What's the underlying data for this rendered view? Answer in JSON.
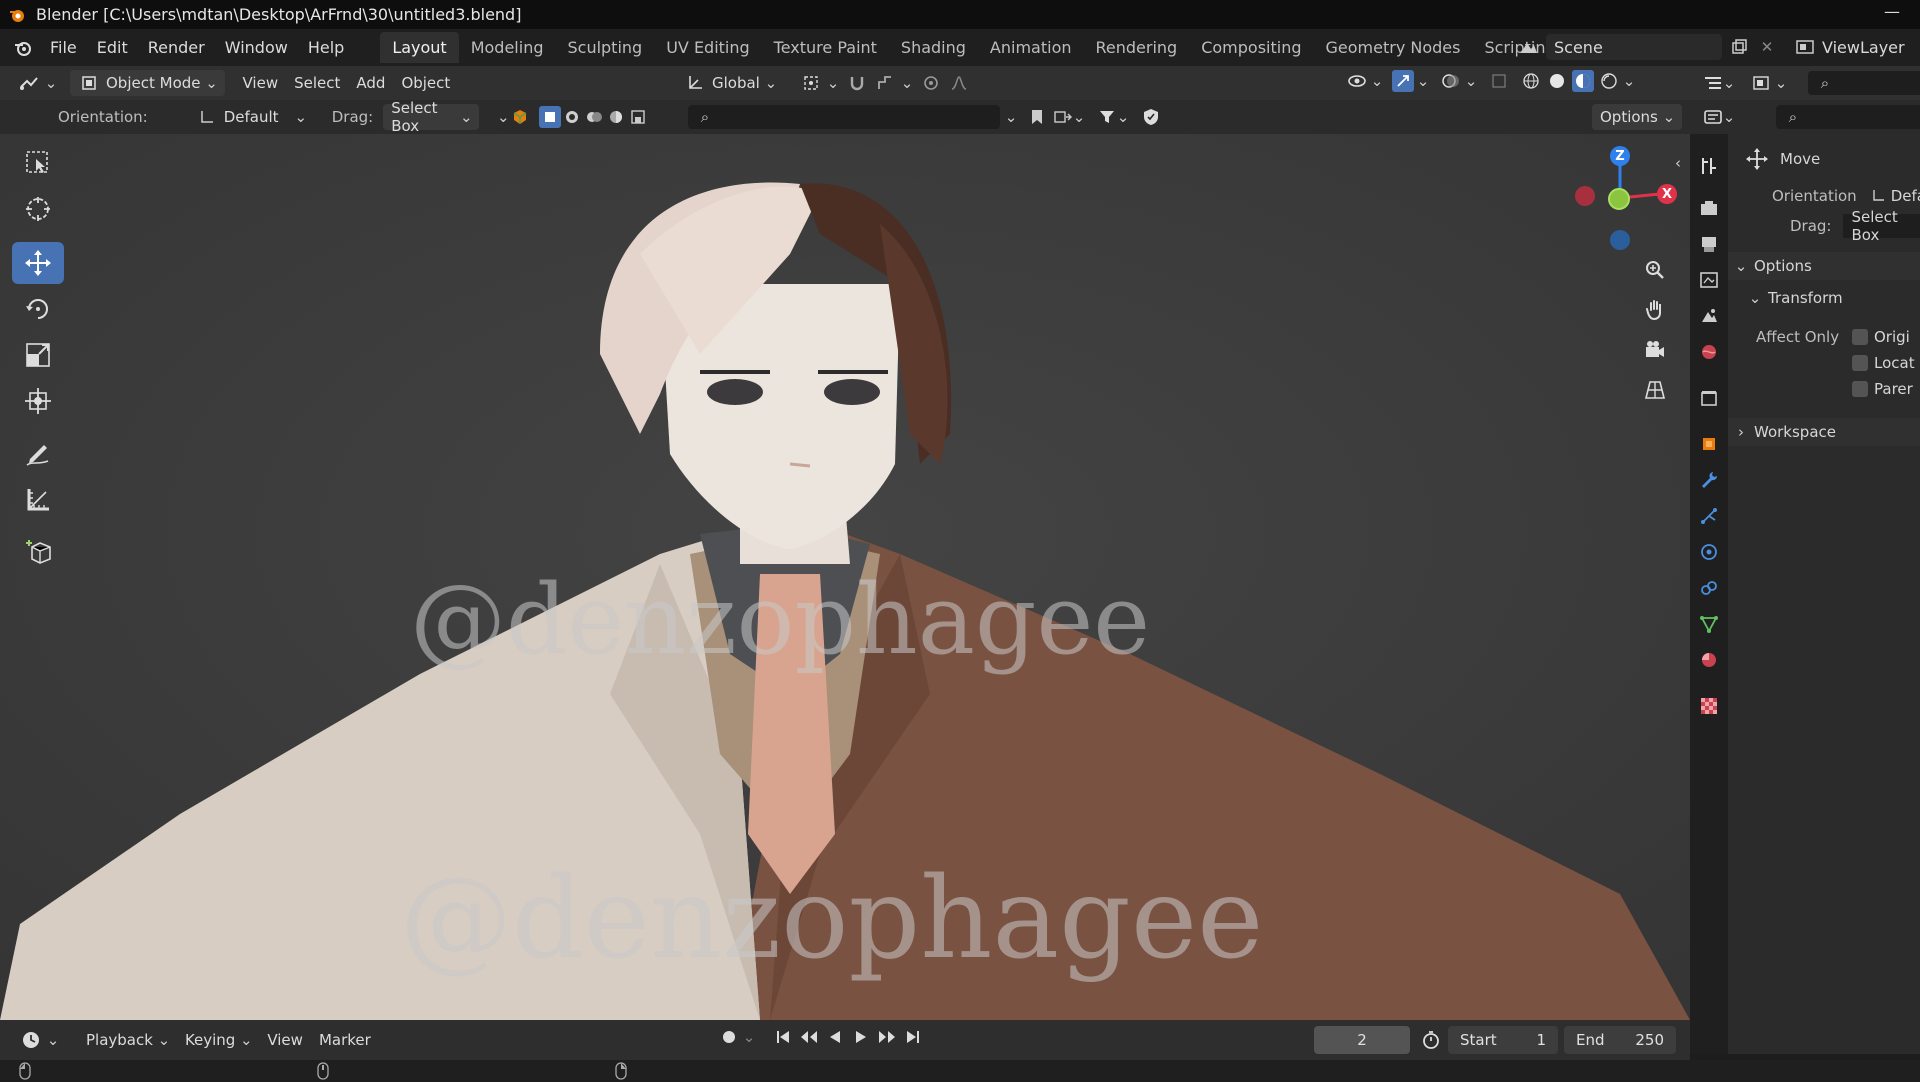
{
  "window": {
    "title": "Blender [C:\\Users\\mdtan\\Desktop\\ArFrnd\\30\\untitled3.blend]",
    "min_glyph": "—"
  },
  "menu": {
    "items": [
      "File",
      "Edit",
      "Render",
      "Window",
      "Help"
    ]
  },
  "workspaces": {
    "tabs": [
      "Layout",
      "Modeling",
      "Sculpting",
      "UV Editing",
      "Texture Paint",
      "Shading",
      "Animation",
      "Rendering",
      "Compositing",
      "Geometry Nodes",
      "Scripting"
    ],
    "active": "Layout",
    "add_glyph": "+"
  },
  "scene": {
    "name": "Scene",
    "view_layer": "ViewLayer"
  },
  "header": {
    "mode": "Object Mode",
    "menus": [
      "View",
      "Select",
      "Add",
      "Object"
    ],
    "transform_space": "Global",
    "orientation_label": "Orientation:",
    "orientation_value": "Default",
    "drag_label": "Drag:",
    "drag_value": "Select Box",
    "options_label": "Options"
  },
  "watermark": {
    "text": "@denzophagee"
  },
  "gizmo": {
    "z": "Z",
    "x": "X"
  },
  "properties": {
    "tool_name": "Move",
    "orientation_label": "Orientation",
    "orientation_value": "Defa",
    "drag_label": "Drag:",
    "drag_value": "Select Box",
    "options_header": "Options",
    "transform_header": "Transform",
    "affect_only_label": "Affect Only",
    "affect_items": [
      "Origi",
      "Locat",
      "Parer"
    ],
    "workspace_header": "Workspace"
  },
  "timeline": {
    "menus": [
      "Playback",
      "Keying",
      "View",
      "Marker"
    ],
    "current_frame": "2",
    "start_label": "Start",
    "start_value": "1",
    "end_label": "End",
    "end_value": "250"
  },
  "colors": {
    "accent": "#4772b3",
    "axis_x": "#e0334a",
    "axis_y": "#8bc53f",
    "axis_z": "#2f80ed"
  }
}
